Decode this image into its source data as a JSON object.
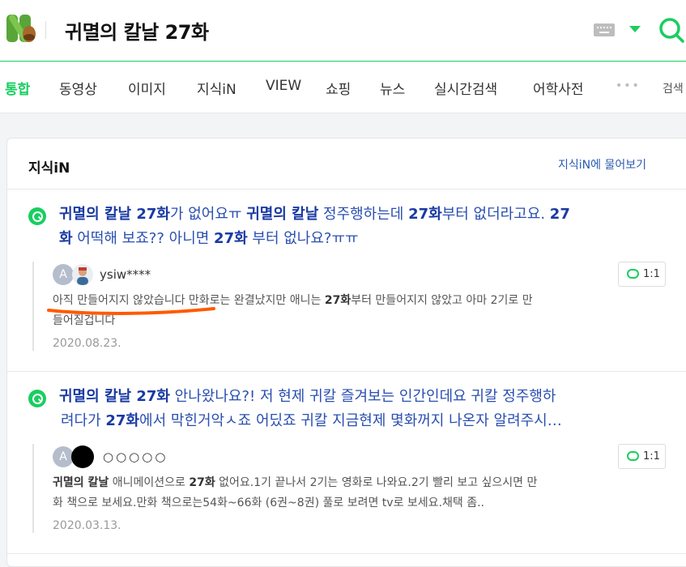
{
  "header": {
    "query": "귀멸의 칼날 27화"
  },
  "tabs": [
    {
      "label": "통합"
    },
    {
      "label": "동영상"
    },
    {
      "label": "이미지"
    },
    {
      "label": "지식iN"
    },
    {
      "label": "VIEW"
    },
    {
      "label": "쇼핑"
    },
    {
      "label": "뉴스"
    },
    {
      "label": "실시간검색"
    },
    {
      "label": "어학사전"
    }
  ],
  "tab_more": "•••",
  "tab_search": "검색",
  "section": {
    "title": "지식iN",
    "ask_link": "지식iN에 물어보기"
  },
  "results": [
    {
      "q_line1": [
        {
          "t": "귀멸의 칼날 27화",
          "b": true
        },
        {
          "t": "가 없어요ㅠ ",
          "b": false
        },
        {
          "t": "귀멸의 칼날",
          "b": true
        },
        {
          "t": " 정주행하는데 ",
          "b": false
        },
        {
          "t": "27화",
          "b": true
        },
        {
          "t": "부터 없더라고요. ",
          "b": false
        },
        {
          "t": "27",
          "b": true
        }
      ],
      "q_line2": [
        {
          "t": "화",
          "b": true
        },
        {
          "t": " 어떡해 보죠?? 아니면 ",
          "b": false
        },
        {
          "t": "27화",
          "b": true
        },
        {
          "t": " 부터 없나요?ㅠㅠ",
          "b": false
        }
      ],
      "avatar_letter": "A",
      "user": "ysiw****",
      "count": "1:1",
      "a_line1": [
        {
          "t": "아직 만들어지지 않았습니다",
          "b": false
        },
        {
          "t": " 만화로는 완결났지만 애니는 ",
          "b": false
        },
        {
          "t": "27화",
          "b": true
        },
        {
          "t": "부터 만들어지지 않았고 아마 2기로 만",
          "b": false
        }
      ],
      "a_line2": "들어질겁니다",
      "date": "2020.08.23."
    },
    {
      "q_line1": [
        {
          "t": "귀멸의 칼날 27화",
          "b": true
        },
        {
          "t": " 안나왔나요?! 저 현제 귀칼 즐겨보는 인간인데요 귀칼 정주행하",
          "b": false
        }
      ],
      "q_line2": [
        {
          "t": "려다가 ",
          "b": false
        },
        {
          "t": "27화",
          "b": true
        },
        {
          "t": "에서 막힌거악ㅅ죠 어딨죠 귀칼 지금현제 몇화꺼지 나온자 알려주시…",
          "b": false
        }
      ],
      "avatar_letter": "A",
      "user": "○○○○○",
      "count": "1:1",
      "a_line1": [
        {
          "t": "귀멸의 칼날",
          "b": true
        },
        {
          "t": " 애니메이션으로 ",
          "b": false
        },
        {
          "t": "27화",
          "b": true
        },
        {
          "t": " 없어요.1기 끝나서 2기는 영화로 나와요.2기 빨리 보고 싶으시면 만",
          "b": false
        }
      ],
      "a_line2": "화 책으로 보세요.만화 책으로는54화~66화 (6권~8권) 풀로 보려면 tv로 보세요.채택 좀..",
      "date": "2020.03.13."
    }
  ],
  "colors": {
    "brand": "#19ce60",
    "link": "#2a4fb0",
    "underline_mark": "#ff5a00"
  },
  "icons": [
    "naver-logo-icon",
    "keyboard-icon",
    "chevron-down-icon",
    "search-icon",
    "knowledge-q-icon",
    "chat-bubble-icon"
  ]
}
